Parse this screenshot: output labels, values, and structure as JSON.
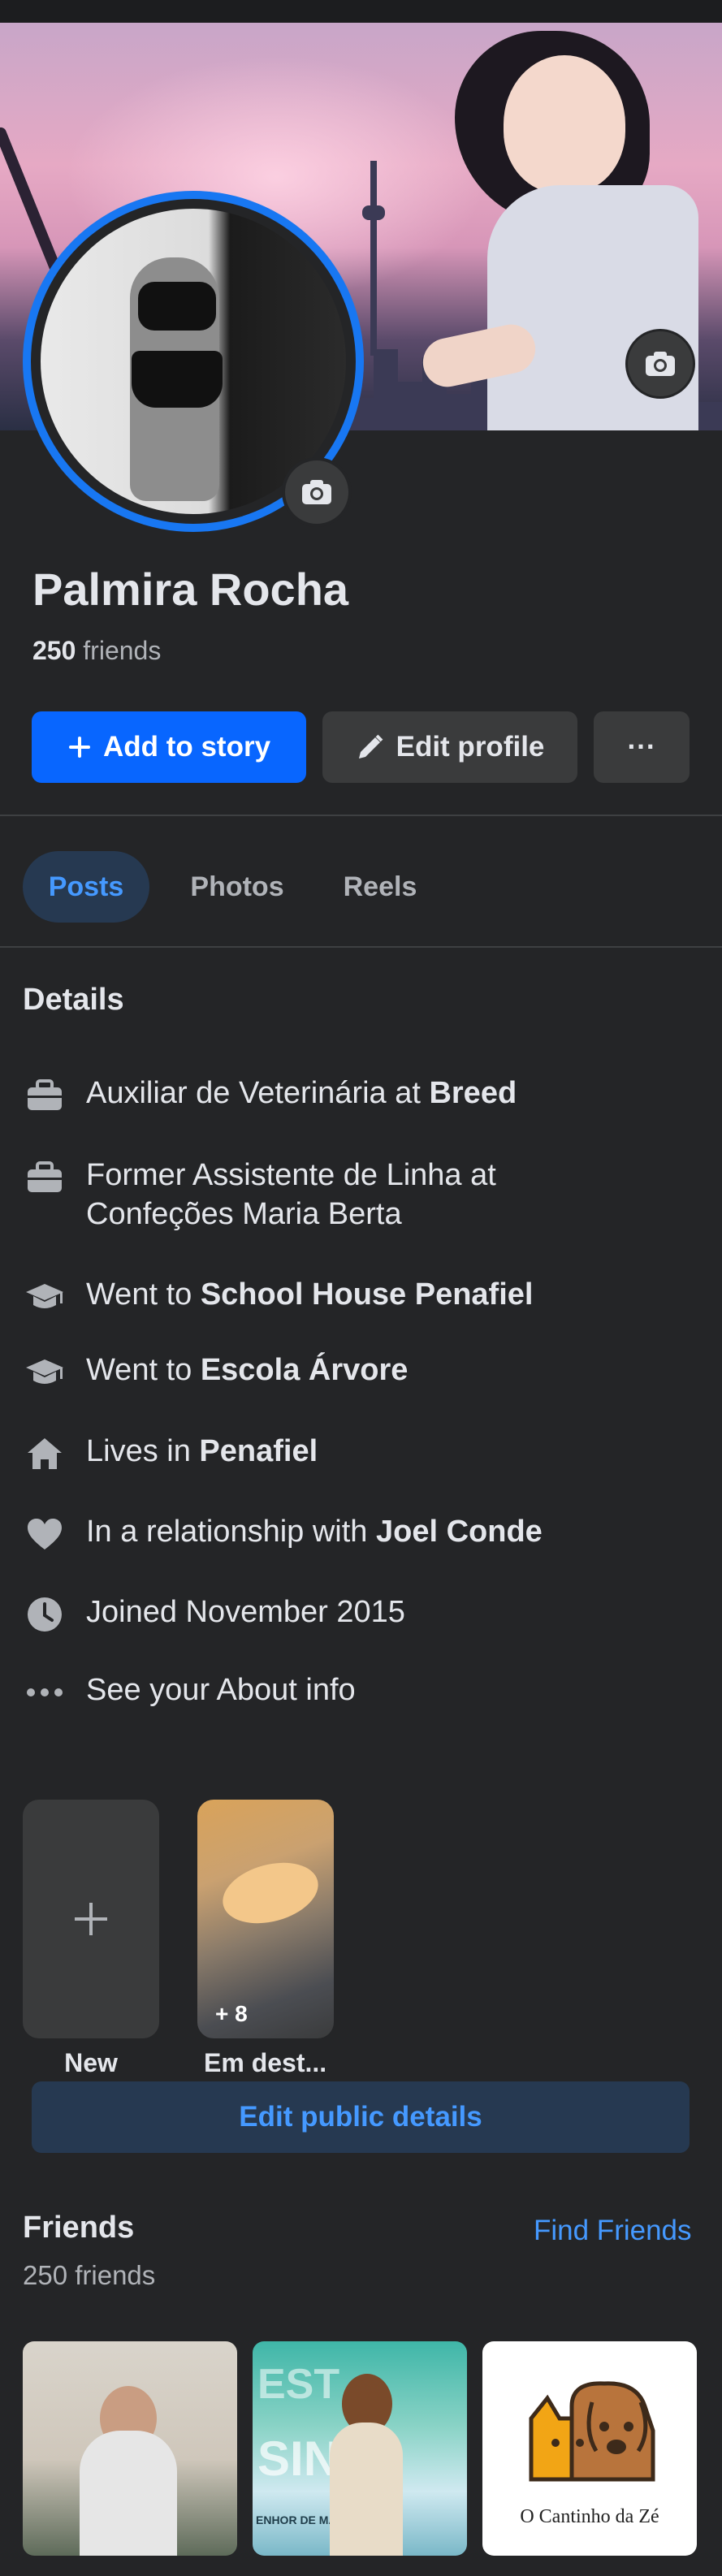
{
  "profile": {
    "name": "Palmira Rocha",
    "friends_count": "250",
    "friends_label": " friends"
  },
  "actions": {
    "add_story": "Add to story",
    "edit_profile": "Edit profile",
    "more": "···"
  },
  "tabs": [
    {
      "label": "Posts",
      "active": true
    },
    {
      "label": "Photos",
      "active": false
    },
    {
      "label": "Reels",
      "active": false
    }
  ],
  "details": {
    "title": "Details",
    "items": [
      {
        "icon": "briefcase-icon",
        "pre": "Auxiliar de Veterinária at ",
        "bold": "Breed"
      },
      {
        "icon": "briefcase-icon",
        "pre": "Former Assistente de Linha at Confeções Maria Berta",
        "bold": ""
      },
      {
        "icon": "graduation-cap-icon",
        "pre": "Went to ",
        "bold": "School House Penafiel"
      },
      {
        "icon": "graduation-cap-icon",
        "pre": "Went to ",
        "bold": "Escola Árvore"
      },
      {
        "icon": "home-icon",
        "pre": "Lives in ",
        "bold": "Penafiel"
      },
      {
        "icon": "heart-icon",
        "pre": "In a relationship with ",
        "bold": "Joel Conde"
      },
      {
        "icon": "clock-icon",
        "pre": "Joined November 2015",
        "bold": ""
      },
      {
        "icon": "more-dots-icon",
        "pre": "See your About info",
        "bold": ""
      }
    ]
  },
  "highlights": {
    "new_label": "New",
    "featured_label": "Em dest...",
    "featured_count": "+ 8"
  },
  "edit_public_details": "Edit public details",
  "friends": {
    "title": "Friends",
    "subtitle": "250 friends",
    "find_link": "Find Friends",
    "page_logo_text": "O Cantinho da Zé",
    "banner_text_1": "EST",
    "banner_text_2": "SINH",
    "banner_text_3": "ENHOR DE MATOSINHOS"
  },
  "colors": {
    "background": "#242527",
    "accent": "#0866ff",
    "accent_text": "#4599ff",
    "surface": "#3a3b3c"
  }
}
